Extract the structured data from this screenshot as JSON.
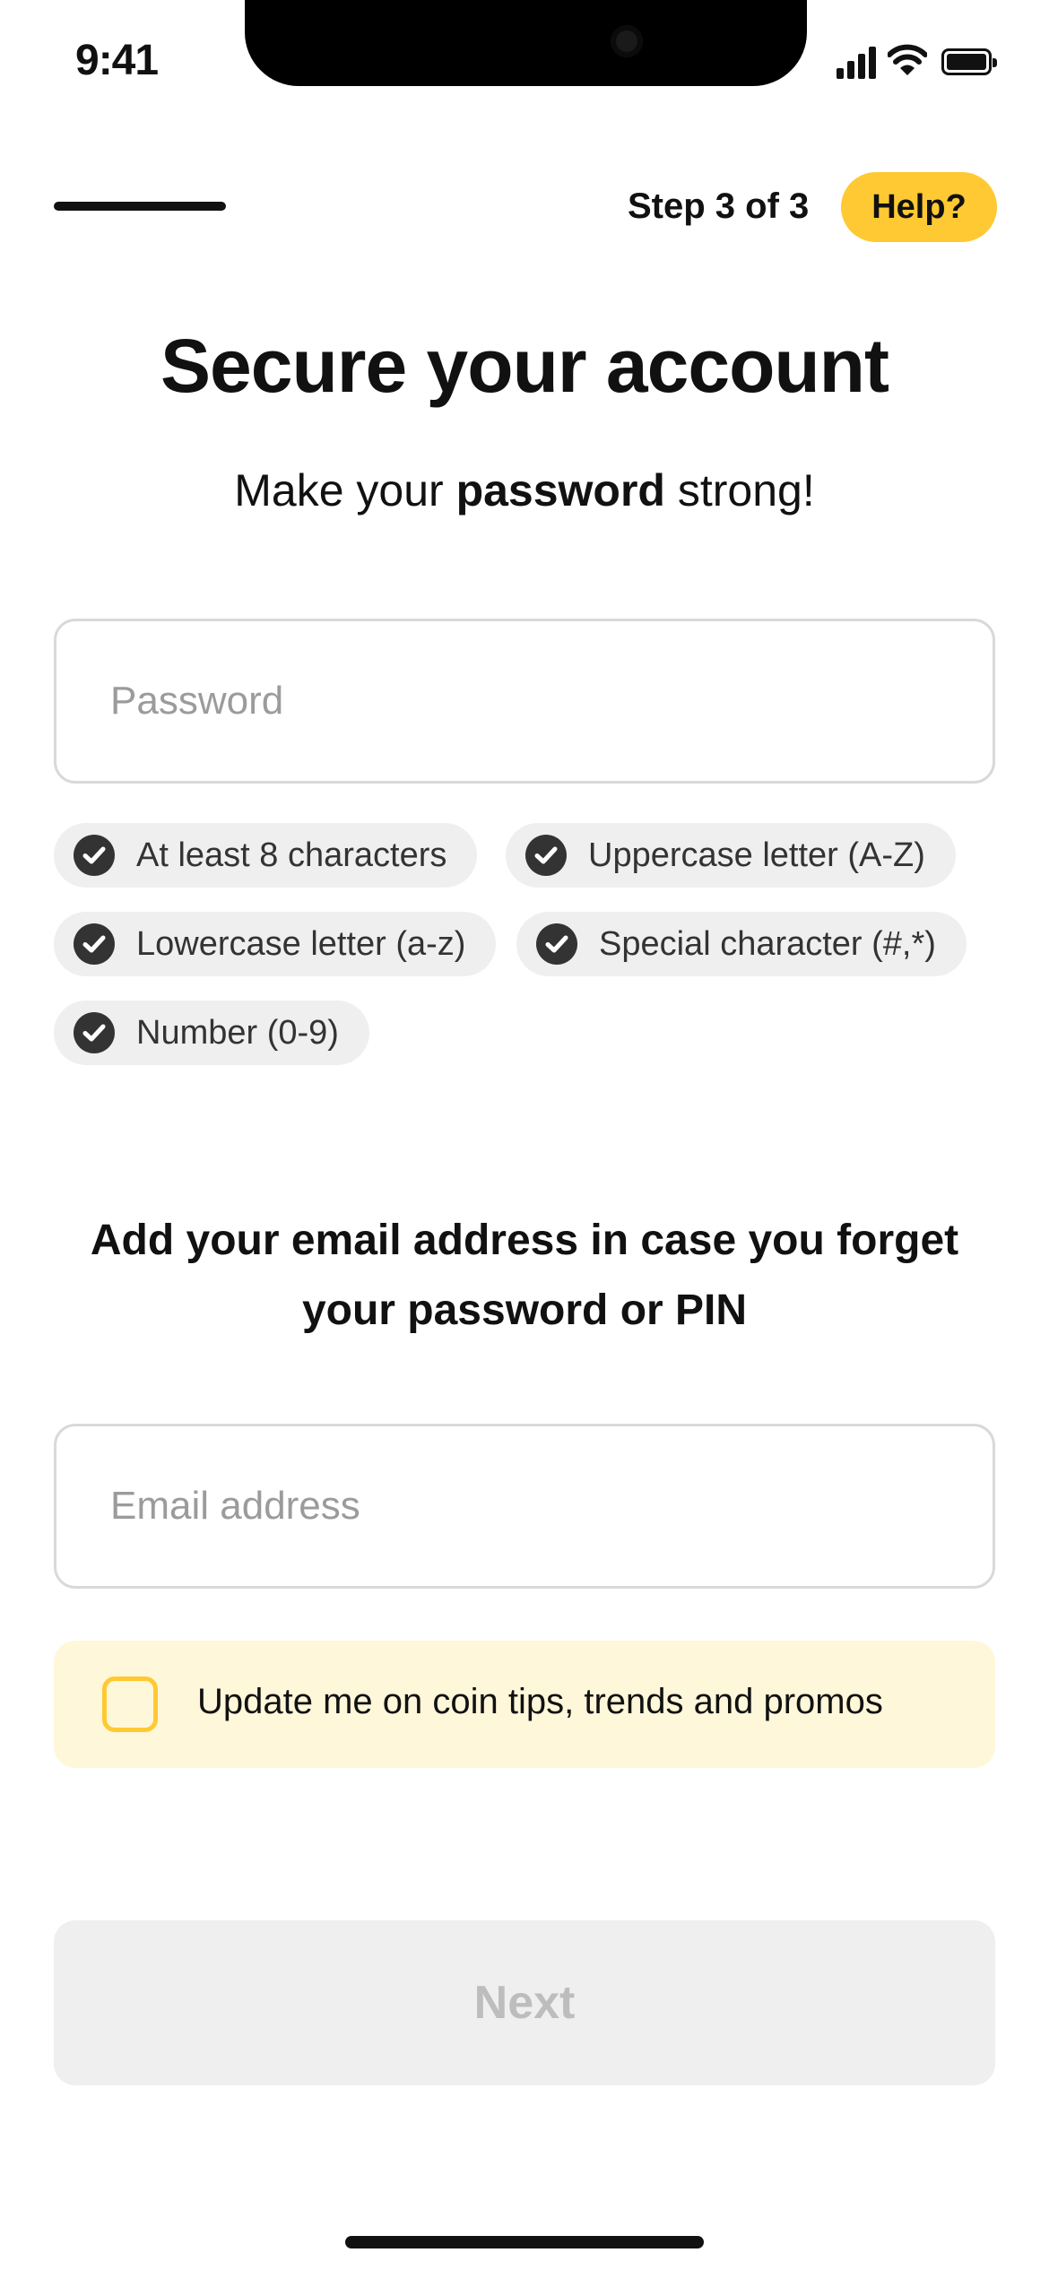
{
  "status_bar": {
    "time": "9:41"
  },
  "header": {
    "step_text": "Step 3 of 3",
    "help_label": "Help?"
  },
  "page": {
    "title": "Secure your account",
    "subtitle_prefix": "Make your ",
    "subtitle_bold": "password",
    "subtitle_suffix": " strong!"
  },
  "password": {
    "placeholder": "Password",
    "value": "",
    "requirements": [
      {
        "label": "At least 8 characters",
        "met": true
      },
      {
        "label": "Uppercase letter (A-Z)",
        "met": true
      },
      {
        "label": "Lowercase letter (a-z)",
        "met": true
      },
      {
        "label": "Special character (#,*)",
        "met": true
      },
      {
        "label": "Number (0-9)",
        "met": true
      }
    ]
  },
  "email": {
    "heading": "Add your email address in case you forget your password or PIN",
    "placeholder": "Email address",
    "value": ""
  },
  "optin": {
    "label": "Update me on coin tips, trends and promos",
    "checked": false
  },
  "footer": {
    "next_label": "Next",
    "next_enabled": false
  },
  "colors": {
    "accent": "#FFC933",
    "optin_bg": "#FFF7D9",
    "chip_bg": "#EFEFEF",
    "check": "#333333",
    "disabled_text": "#BDBDBD"
  }
}
